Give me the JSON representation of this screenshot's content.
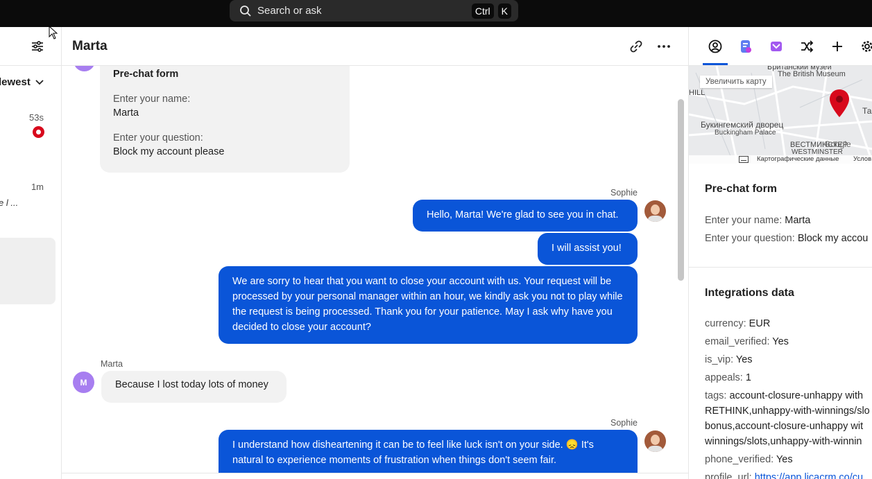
{
  "topbar": {
    "search_label": "Search or ask",
    "shortcut_ctrl": "Ctrl",
    "shortcut_k": "K"
  },
  "left": {
    "sort_label": "lewest",
    "items": [
      {
        "time": "53s"
      },
      {
        "time": "1m",
        "preview": "e l ..."
      }
    ]
  },
  "chat": {
    "title": "Marta",
    "prechat": {
      "title": "Pre-chat form",
      "q1": "Enter your name:",
      "a1": "Marta",
      "q2": "Enter your question:",
      "a2": "Block my account please"
    },
    "messages": [
      {
        "sender": "Sophie",
        "text": "Hello, Marta! We're glad to see you in chat."
      },
      {
        "text": "I will assist you!"
      },
      {
        "text": "We are sorry to hear that you want to close your account with us. Your request will be processed by your personal manager within an hour, we kindly ask you not to play while the request is being processed. Thank you for your patience. May I ask why have you decided to close your account?"
      },
      {
        "sender": "Marta",
        "avatar": "M",
        "text": "Because I lost today lots of money"
      },
      {
        "sender": "Sophie",
        "text": "I understand how disheartening it can be to feel like luck isn't on your side. 😞 It's natural to experience moments of frustration when things don't seem fair."
      }
    ]
  },
  "right": {
    "map": {
      "zoom_label": "Увеличить карту",
      "labels": [
        "Британский музей",
        "The British Museum",
        "Букингемский дворец",
        "Buckingham Palace",
        "ВЕСТМИНСТЕР",
        "WESTMINSTER",
        "HILL",
        "Та"
      ],
      "google": "Google",
      "footer_data": "Картографические данные",
      "footer_terms": "Услов"
    },
    "prechat": {
      "title": "Pre-chat form",
      "rows": [
        {
          "k": "Enter your name:",
          "v": "Marta"
        },
        {
          "k": "Enter your question:",
          "v": "Block my accou"
        }
      ]
    },
    "integrations": {
      "title": "Integrations data",
      "rows": [
        {
          "k": "currency:",
          "v": "EUR"
        },
        {
          "k": "email_verified:",
          "v": "Yes"
        },
        {
          "k": "is_vip:",
          "v": "Yes"
        },
        {
          "k": "appeals:",
          "v": "1"
        }
      ],
      "tags_key": "tags:",
      "tags_lines": [
        "account-closure-unhappy with",
        "RETHINK,unhappy-with-winnings/slo",
        "bonus,account-closure-unhappy wit",
        "winnings/slots,unhappy-with-winnin"
      ],
      "phone_key": "phone_verified:",
      "phone_val": "Yes",
      "profile_key": "profile_url:",
      "profile_val": "https://app.licacrm.co/cu"
    }
  },
  "colors": {
    "accent": "#0a55d8",
    "bubble_in": "#f2f2f2",
    "avatar_m": "#a77ef0",
    "status_red": "#d8091c",
    "pin_red": "#d8091c"
  }
}
